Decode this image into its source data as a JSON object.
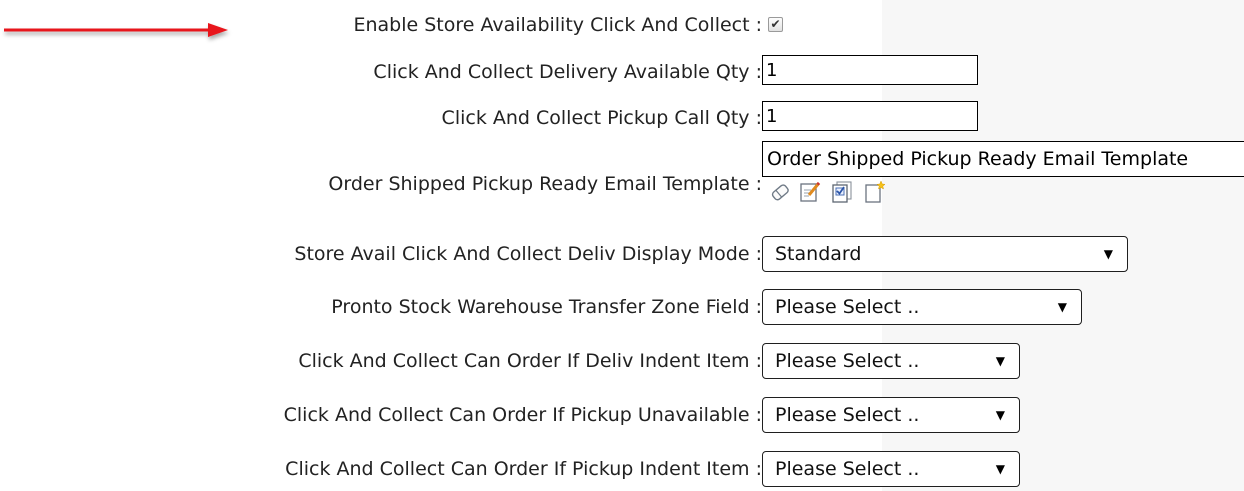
{
  "settings": {
    "enable_store_availability": {
      "label": "Enable Store Availability Click And Collect :",
      "checked": true,
      "check_glyph": "✔"
    },
    "delivery_qty": {
      "label": "Click And Collect Delivery Available Qty :",
      "value": "1"
    },
    "pickup_call_qty": {
      "label": "Click And Collect Pickup Call Qty :",
      "value": "1"
    },
    "email_template": {
      "label": "Order Shipped Pickup Ready Email Template :",
      "value": "Order Shipped Pickup Ready Email Template",
      "tools": [
        "eraser-icon",
        "edit-icon",
        "checklist-icon",
        "new-document-icon"
      ]
    },
    "deliv_display_mode": {
      "label": "Store Avail Click And Collect Deliv Display Mode :",
      "selected": "Standard"
    },
    "transfer_zone_field": {
      "label": "Pronto Stock Warehouse Transfer Zone Field :",
      "selected": "Please Select .."
    },
    "order_if_deliv_indent": {
      "label": "Click And Collect Can Order If Deliv Indent Item :",
      "selected": "Please Select .."
    },
    "order_if_pickup_unavailable": {
      "label": "Click And Collect Can Order If Pickup Unavailable :",
      "selected": "Please Select .."
    },
    "order_if_pickup_indent": {
      "label": "Click And Collect Can Order If Pickup Indent Item :",
      "selected": "Please Select .."
    },
    "dropdown_caret": "▼"
  },
  "colors": {
    "arrow": "#e8141b",
    "border": "#000000",
    "panel": "#f7f7f7"
  }
}
